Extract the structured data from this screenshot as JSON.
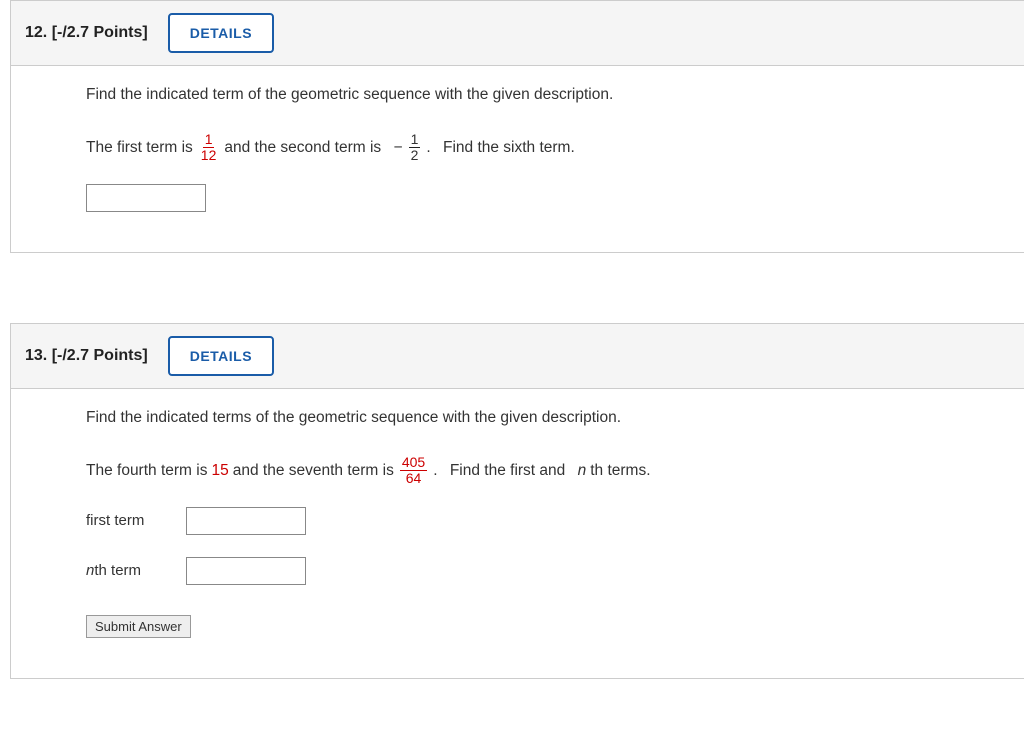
{
  "q12": {
    "number": "12.",
    "points": "[-/2.7 Points]",
    "details_label": "DETAILS",
    "instruction": "Find the indicated term of the geometric sequence with the given description.",
    "text1": "The first term is",
    "frac1": {
      "num": "1",
      "den": "12"
    },
    "text2": "and the second term is",
    "minus": "−",
    "frac2": {
      "num": "1",
      "den": "2"
    },
    "period1": ".",
    "text3": "Find the sixth term."
  },
  "q13": {
    "number": "13.",
    "points": "[-/2.7 Points]",
    "details_label": "DETAILS",
    "instruction": "Find the indicated terms of the geometric sequence with the given description.",
    "text1": "The fourth term is",
    "val1": "15",
    "text2": "and the seventh term is",
    "frac1": {
      "num": "405",
      "den": "64"
    },
    "period1": ".",
    "text3": "Find the first and",
    "nth_italic": "n",
    "text3b": "th terms.",
    "first_label": "first term",
    "nth_label_n": "n",
    "nth_label_rest": "th term",
    "submit_label": "Submit Answer"
  }
}
